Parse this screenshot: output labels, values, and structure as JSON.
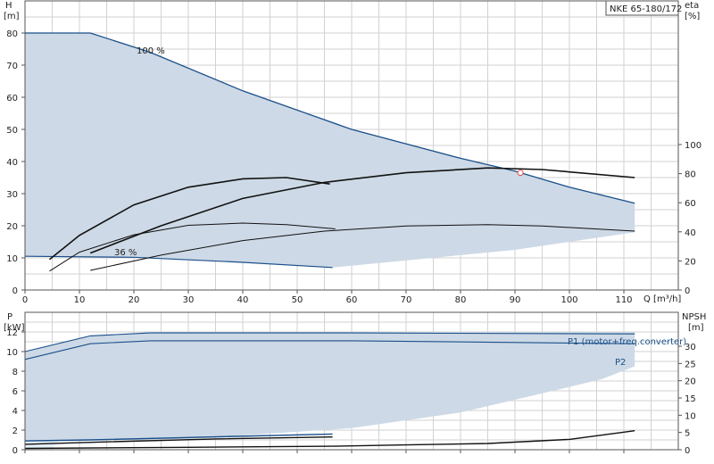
{
  "chart_data": [
    {
      "type": "line",
      "title": "NKE 65-180/172",
      "ylabel": "H",
      "yunit": "[m]",
      "y2label": "eta",
      "y2unit": "[%]",
      "xlabel": "Q [m³/h]",
      "xlim": [
        0,
        120
      ],
      "ylim": [
        0,
        90
      ],
      "y2lim": [
        0,
        100
      ],
      "xticks": [
        0,
        10,
        20,
        30,
        40,
        50,
        60,
        70,
        80,
        90,
        100,
        110
      ],
      "yticks": [
        0,
        10,
        20,
        30,
        40,
        50,
        60,
        70,
        80
      ],
      "y2ticks": [
        0,
        20,
        40,
        60,
        80,
        100
      ],
      "annotations": [
        "100 %",
        "36 %"
      ],
      "envelope_upper": [
        [
          0,
          80
        ],
        [
          12,
          80
        ],
        [
          23,
          74
        ],
        [
          40,
          62
        ],
        [
          60,
          50
        ],
        [
          80,
          41
        ],
        [
          90,
          37
        ],
        [
          100,
          32
        ],
        [
          112,
          27
        ]
      ],
      "envelope_lower": [
        [
          0,
          10.5
        ],
        [
          20,
          10.2
        ],
        [
          40,
          8.6
        ],
        [
          56.5,
          7
        ]
      ],
      "envelope_min_speed_lower": [
        [
          90,
          12.5
        ],
        [
          100,
          15
        ],
        [
          112,
          18
        ]
      ],
      "efficiency_area": [
        [
          0,
          80
        ],
        [
          12,
          80
        ],
        [
          10,
          62
        ],
        [
          7.5,
          37
        ],
        [
          5,
          20
        ],
        [
          4,
          10.5
        ],
        [
          0,
          10.5
        ]
      ],
      "series": [
        {
          "name": "",
          "axis": "left",
          "points": [
            [
              4.5,
              9.5
            ],
            [
              10,
              17
            ],
            [
              20,
              26.5
            ],
            [
              30,
              32
            ],
            [
              40,
              34.6
            ],
            [
              48,
              35
            ],
            [
              56,
              33
            ]
          ]
        },
        {
          "name": "",
          "axis": "right",
          "points": [
            [
              4.5,
              13
            ],
            [
              10,
              26
            ],
            [
              20,
              38
            ],
            [
              30,
              44.5
            ],
            [
              40,
              46
            ],
            [
              48,
              45
            ],
            [
              57,
              42
            ]
          ]
        },
        {
          "name": "",
          "axis": "right",
          "points": [
            [
              12,
              13.5
            ],
            [
              25,
              24
            ],
            [
              40,
              34
            ],
            [
              55,
              40.5
            ],
            [
              70,
              44
            ],
            [
              85,
              45
            ],
            [
              95,
              44
            ],
            [
              112,
              40.5
            ]
          ]
        },
        {
          "name": "",
          "axis": "left",
          "points": [
            [
              12,
              11.5
            ],
            [
              25,
              20
            ],
            [
              40,
              28.5
            ],
            [
              55,
              33.5
            ],
            [
              70,
              36.5
            ],
            [
              85,
              38
            ],
            [
              95,
              37.5
            ],
            [
              112,
              35
            ]
          ]
        }
      ],
      "duty_point": [
        91,
        36.5
      ]
    },
    {
      "type": "line",
      "ylabel": "P",
      "yunit": "[kW]",
      "y2label": "NPSH",
      "y2unit": "[m]",
      "xlim": [
        0,
        120
      ],
      "ylim": [
        0,
        14
      ],
      "y2lim": [
        0,
        35
      ],
      "yticks": [
        0,
        2,
        4,
        6,
        8,
        10,
        12
      ],
      "y2ticks": [
        0,
        5,
        10,
        15,
        20,
        25,
        30
      ],
      "area_upper": [
        [
          0,
          10
        ],
        [
          12,
          11.6
        ],
        [
          23,
          12
        ],
        [
          60,
          12
        ],
        [
          112,
          12
        ]
      ],
      "area_lower": [
        [
          112,
          8.5
        ],
        [
          106,
          7.2
        ],
        [
          100,
          6.4
        ],
        [
          80,
          3.8
        ],
        [
          60,
          2.2
        ],
        [
          30,
          1.1
        ],
        [
          0,
          0.8
        ]
      ],
      "efficiency_area": [
        [
          0,
          10
        ],
        [
          12,
          11.6
        ],
        [
          10,
          6
        ],
        [
          7,
          1.5
        ],
        [
          5,
          0.1
        ],
        [
          0,
          0.1
        ]
      ],
      "series": [
        {
          "name": "P1 (motor+freq.converter)",
          "axis": "left",
          "points": [
            [
              0,
              10
            ],
            [
              12,
              11.6
            ],
            [
              23,
              11.9
            ],
            [
              60,
              11.9
            ],
            [
              112,
              11.8
            ]
          ]
        },
        {
          "name": "P2",
          "axis": "left",
          "points": [
            [
              0,
              9.2
            ],
            [
              12,
              10.8
            ],
            [
              23,
              11.1
            ],
            [
              60,
              11.1
            ],
            [
              112,
              10.8
            ]
          ]
        },
        {
          "name": "",
          "axis": "left",
          "points": [
            [
              0,
              0.9
            ],
            [
              12,
              1.0
            ],
            [
              30,
              1.25
            ],
            [
              56.5,
              1.6
            ]
          ]
        },
        {
          "name": "",
          "axis": "left",
          "points": [
            [
              0,
              0.55
            ],
            [
              15,
              0.8
            ],
            [
              35,
              1.1
            ],
            [
              56.5,
              1.3
            ]
          ]
        },
        {
          "name": "",
          "axis": "right",
          "points": [
            [
              0,
              0.4
            ],
            [
              30,
              0.7
            ],
            [
              56.5,
              1.0
            ]
          ]
        },
        {
          "name": "",
          "axis": "right",
          "points": [
            [
              56.5,
              1.0
            ],
            [
              70,
              1.4
            ],
            [
              85,
              1.8
            ],
            [
              100,
              3.0
            ],
            [
              112,
              5.5
            ]
          ]
        }
      ]
    }
  ]
}
